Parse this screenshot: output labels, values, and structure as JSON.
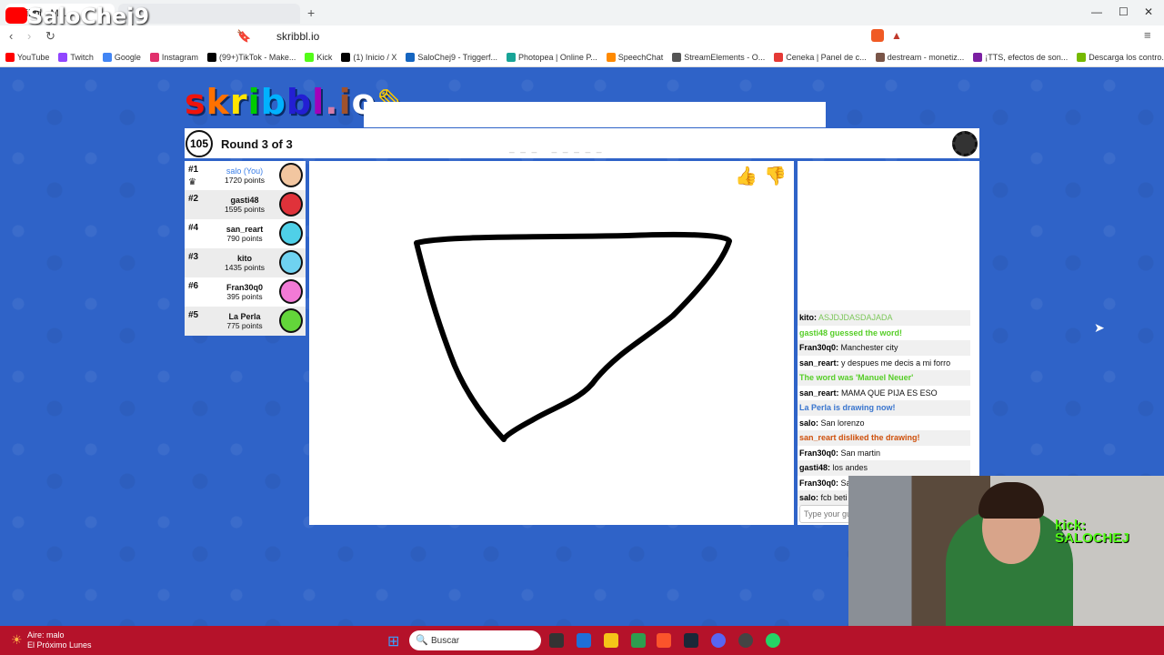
{
  "overlay": {
    "channel": "SaloChej9"
  },
  "browser": {
    "url": "skribbl.io",
    "bookmarks": [
      "YouTube",
      "Twitch",
      "Google",
      "Instagram",
      "(99+)TikTok - Make...",
      "Kick",
      "(1) Inicio / X",
      "SaloChej9 - Triggerf...",
      "Photopea | Online P...",
      "SpeechChat",
      "StreamElements - O...",
      "Ceneka | Panel de c...",
      "destream - monetiz...",
      "¡TTS, efectos de son...",
      "Descarga los contro..."
    ]
  },
  "game": {
    "logo": "skribbl.io",
    "timer": "105",
    "round": "Round 3 of 3",
    "players": [
      {
        "rank": "#1",
        "name": "salo (You)",
        "points": "1720 points",
        "you": true,
        "color": "#f2c6a0"
      },
      {
        "rank": "#2",
        "name": "gasti48",
        "points": "1595 points",
        "you": false,
        "color": "#e0323a"
      },
      {
        "rank": "#4",
        "name": "san_reart",
        "points": "790 points",
        "you": false,
        "color": "#4fd0e8"
      },
      {
        "rank": "#3",
        "name": "kito",
        "points": "1435 points",
        "you": false,
        "color": "#6fd2f0"
      },
      {
        "rank": "#6",
        "name": "Fran30q0",
        "points": "395 points",
        "you": false,
        "color": "#f27ad6"
      },
      {
        "rank": "#5",
        "name": "La Perla",
        "points": "775 points",
        "you": false,
        "color": "#63d63a"
      }
    ],
    "chat": [
      {
        "user": "kito:",
        "text": "ASJDJDASDAJADA",
        "color": "#7cc75a",
        "bold": false
      },
      {
        "user": "",
        "text": "gasti48 guessed the word!",
        "color": "#56ce27",
        "bold": true
      },
      {
        "user": "Fran30q0:",
        "text": "Manchester city",
        "color": "#111",
        "bold": false
      },
      {
        "user": "san_reart:",
        "text": "y despues me decis a mi forro",
        "color": "#111",
        "bold": false
      },
      {
        "user": "",
        "text": "The word was 'Manuel Neuer'",
        "color": "#56ce27",
        "bold": true
      },
      {
        "user": "san_reart:",
        "text": "MAMA QUE PIJA ES ESO",
        "color": "#111",
        "bold": false
      },
      {
        "user": "",
        "text": "La Perla is drawing now!",
        "color": "#3975ce",
        "bold": true
      },
      {
        "user": "salo:",
        "text": "San lorenzo",
        "color": "#111",
        "bold": false
      },
      {
        "user": "",
        "text": "san_reart disliked the drawing!",
        "color": "#ce4f0a",
        "bold": true
      },
      {
        "user": "Fran30q0:",
        "text": "San martin",
        "color": "#111",
        "bold": false
      },
      {
        "user": "gasti48:",
        "text": "los andes",
        "color": "#111",
        "bold": false
      },
      {
        "user": "Fran30q0:",
        "text": "Sa",
        "color": "#111",
        "bold": false
      },
      {
        "user": "salo:",
        "text": "fcb beti",
        "color": "#111",
        "bold": false
      }
    ],
    "chat_placeholder": "Type your gu"
  },
  "webcam": {
    "label": "kick: SALOCHEJ"
  },
  "taskbar": {
    "weather_line1": "Aire: malo",
    "weather_line2": "El Próximo Lunes",
    "search": "Buscar"
  }
}
